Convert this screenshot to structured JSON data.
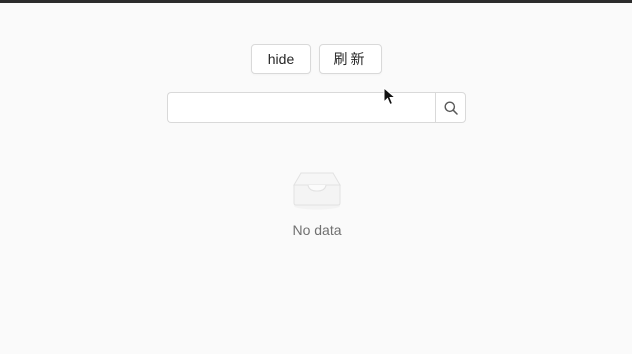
{
  "toolbar": {
    "hide_label": "hide",
    "refresh_label": "刷新"
  },
  "search": {
    "value": "",
    "placeholder": "",
    "icon": "search-icon"
  },
  "empty_state": {
    "icon": "inbox-icon",
    "text": "No data"
  },
  "colors": {
    "background": "#fafafa",
    "border": "#d9d9d9",
    "text": "#262626",
    "muted_text": "#707070"
  }
}
